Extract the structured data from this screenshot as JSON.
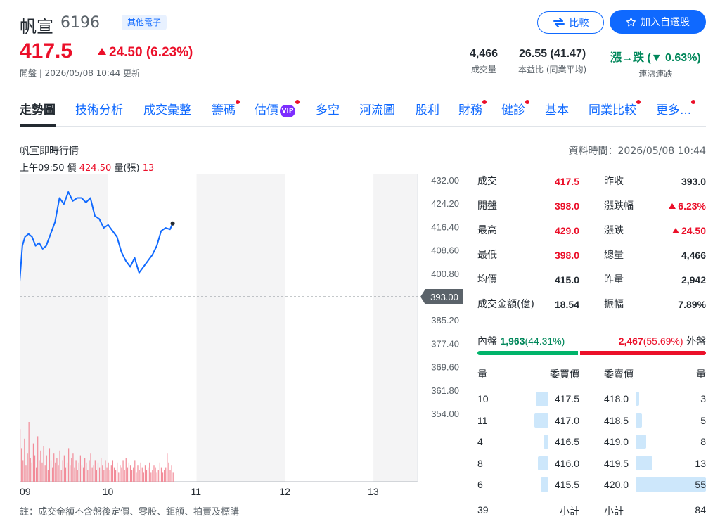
{
  "header": {
    "name": "帆宣",
    "code": "6196",
    "tag": "其他電子",
    "price": "417.5",
    "change": "24.50 (6.23%)",
    "update": "開盤 | 2026/05/08 10:44 更新",
    "compare_label": "比較",
    "watch_label": "加入自選股",
    "stats": [
      {
        "value": "4,466",
        "label": "成交量"
      },
      {
        "value": "26.55 (41.47)",
        "label": "本益比 (同業平均)"
      },
      {
        "value": "漲→跌 (▼ 0.63%)",
        "label": "連漲連跌"
      }
    ],
    "colors": {
      "up": "#eb0f29",
      "down": "#00875a",
      "accent": "#0f69ff"
    }
  },
  "tabs": [
    {
      "label": "走勢圖",
      "active": true,
      "dot": false
    },
    {
      "label": "技術分析",
      "dot": false
    },
    {
      "label": "成交彙整",
      "dot": false
    },
    {
      "label": "籌碼",
      "dot": true
    },
    {
      "label": "估價",
      "dot": true,
      "vip": "VIP"
    },
    {
      "label": "多空",
      "dot": false
    },
    {
      "label": "河流圖",
      "dot": false
    },
    {
      "label": "股利",
      "dot": false
    },
    {
      "label": "財務",
      "dot": true
    },
    {
      "label": "健診",
      "dot": true
    },
    {
      "label": "基本",
      "dot": false
    },
    {
      "label": "同業比較",
      "dot": true
    },
    {
      "label": "更多...",
      "dot": true
    }
  ],
  "section": {
    "title": "帆宣即時行情",
    "data_time": "資料時間：2026/05/08 10:44",
    "hover_time": "上午09:50",
    "hover_price_label": "價",
    "hover_price": "424.50",
    "hover_vol_label": "量(張)",
    "hover_vol": "13",
    "note": "註：成交金額不含盤後定價、零股、鉅額、拍賣及標購"
  },
  "chart_data": {
    "type": "line",
    "y_ticks": [
      "432.00",
      "424.20",
      "416.40",
      "408.60",
      "400.80",
      "393.00",
      "385.20",
      "377.40",
      "369.60",
      "361.80",
      "354.00"
    ],
    "ylim": [
      354.0,
      432.0
    ],
    "reference": "393.00",
    "x_ticks": [
      "09",
      "10",
      "11",
      "12",
      "13"
    ],
    "x_hours": [
      9,
      13.5
    ],
    "x": [
      9.0,
      9.03,
      9.06,
      9.1,
      9.14,
      9.18,
      9.22,
      9.26,
      9.3,
      9.35,
      9.4,
      9.45,
      9.5,
      9.55,
      9.6,
      9.65,
      9.7,
      9.75,
      9.8,
      9.85,
      9.9,
      9.95,
      10.0,
      10.05,
      10.1,
      10.15,
      10.2,
      10.25,
      10.3,
      10.35,
      10.4,
      10.45,
      10.5,
      10.55,
      10.6,
      10.65,
      10.7,
      10.73
    ],
    "y": [
      398.0,
      410.0,
      413.0,
      414.0,
      413.0,
      410.0,
      411.0,
      409.0,
      410.0,
      414.0,
      418.0,
      426.0,
      424.0,
      428.0,
      425.0,
      426.0,
      426.0,
      424.5,
      426.0,
      420.0,
      419.0,
      416.0,
      417.0,
      415.0,
      413.0,
      408.0,
      405.0,
      403.0,
      406.0,
      401.0,
      403.0,
      405.0,
      407.0,
      410.0,
      415.0,
      416.0,
      415.5,
      417.5
    ],
    "volume": [
      22,
      14,
      9,
      18,
      7,
      12,
      25,
      10,
      8,
      16,
      11,
      6,
      19,
      9,
      13,
      8,
      15,
      7,
      11,
      5,
      14,
      9,
      6,
      12,
      8,
      10,
      7,
      13,
      5,
      9,
      11,
      6,
      8,
      14,
      7,
      10,
      12,
      6,
      9,
      5,
      8,
      11,
      7,
      6,
      10,
      8,
      5,
      9,
      12,
      6,
      7,
      9,
      5,
      8,
      6,
      10,
      7,
      5,
      9,
      6,
      8,
      5,
      7,
      9,
      6,
      5,
      8,
      4,
      7,
      6,
      9,
      5,
      10,
      6,
      8,
      7,
      5,
      6,
      9,
      4,
      7,
      5,
      8,
      6,
      4,
      7,
      5,
      6,
      8,
      4,
      5,
      7,
      6,
      4,
      5,
      8,
      6,
      4,
      5,
      6,
      12,
      8,
      5,
      7,
      4
    ]
  },
  "quote": {
    "left": [
      {
        "label": "成交",
        "value": "417.5"
      },
      {
        "label": "開盤",
        "value": "398.0"
      },
      {
        "label": "最高",
        "value": "429.0"
      },
      {
        "label": "最低",
        "value": "398.0"
      },
      {
        "label": "均價",
        "value": "415.0"
      },
      {
        "label": "成交金額(億)",
        "value": "18.54"
      }
    ],
    "right": [
      {
        "label": "昨收",
        "value": "393.0"
      },
      {
        "label": "漲跌幅",
        "value": "6.23%"
      },
      {
        "label": "漲跌",
        "value": "24.50"
      },
      {
        "label": "總量",
        "value": "4,466"
      },
      {
        "label": "昨量",
        "value": "2,942"
      },
      {
        "label": "振幅",
        "value": "7.89%"
      }
    ]
  },
  "inout": {
    "in_label": "內盤",
    "in_value": "1,963",
    "in_pct": "(44.31%)",
    "in_ratio": 0.4431,
    "out_value": "2,467",
    "out_pct": "(55.69%)",
    "out_label": "外盤"
  },
  "orderbook": {
    "headers": [
      "量",
      "委買價",
      "委賣價",
      "量"
    ],
    "bids": [
      {
        "qty": "10",
        "price": "417.5"
      },
      {
        "qty": "11",
        "price": "417.0"
      },
      {
        "qty": "4",
        "price": "416.5"
      },
      {
        "qty": "8",
        "price": "416.0"
      },
      {
        "qty": "6",
        "price": "415.5"
      }
    ],
    "asks": [
      {
        "price": "418.0",
        "qty": "3"
      },
      {
        "price": "418.5",
        "qty": "5"
      },
      {
        "price": "419.0",
        "qty": "8"
      },
      {
        "price": "419.5",
        "qty": "13"
      },
      {
        "price": "420.0",
        "qty": "55"
      }
    ],
    "bid_total": "39",
    "subtotal_label": "小計",
    "ask_total": "84"
  }
}
